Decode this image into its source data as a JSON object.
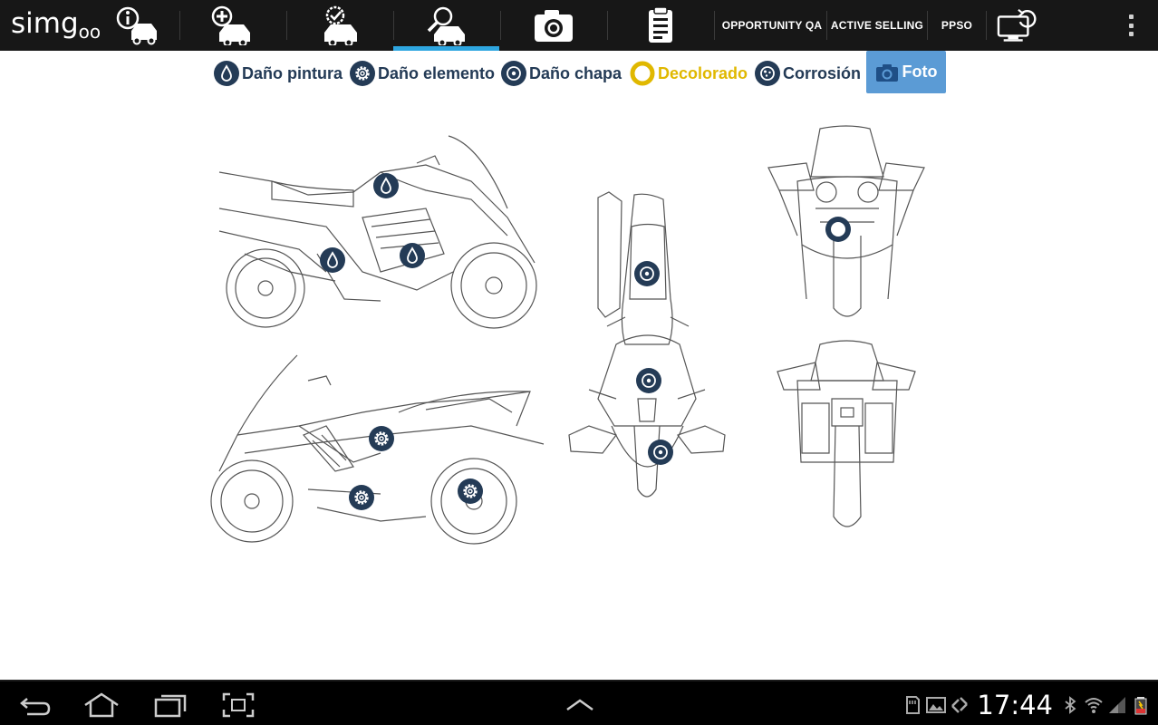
{
  "app": {
    "logo_main": "simg",
    "logo_sub": "oo"
  },
  "toolbar": {
    "tabs": [
      {
        "icon": "info-car-icon"
      },
      {
        "icon": "add-car-icon"
      },
      {
        "icon": "check-car-icon"
      },
      {
        "icon": "inspect-car-icon",
        "active": true
      },
      {
        "icon": "camera-icon"
      },
      {
        "icon": "clipboard-icon"
      }
    ],
    "links": [
      "OPPORTUNITY QA",
      "ACTIVE SELLING",
      "PPSO"
    ],
    "sync_icon": "monitor-sync-icon",
    "overflow_icon": "overflow-menu-icon"
  },
  "legend": {
    "paint_damage": "Daño pintura",
    "element_damage": "Daño elemento",
    "sheet_damage": "Daño chapa",
    "discolored": "Decolorado",
    "corrosion": "Corrosión",
    "photo": "Foto"
  },
  "colors": {
    "topbar": "#171717",
    "active_tab": "#2ea6e0",
    "marker": "#243b56",
    "discolored": "#e0b800",
    "photo_button": "#5b9bd5"
  },
  "markers": {
    "paint_damage": 3,
    "element_damage": 3,
    "sheet_damage": 3,
    "discolored": 1
  },
  "statusbar": {
    "time": "17:44"
  }
}
